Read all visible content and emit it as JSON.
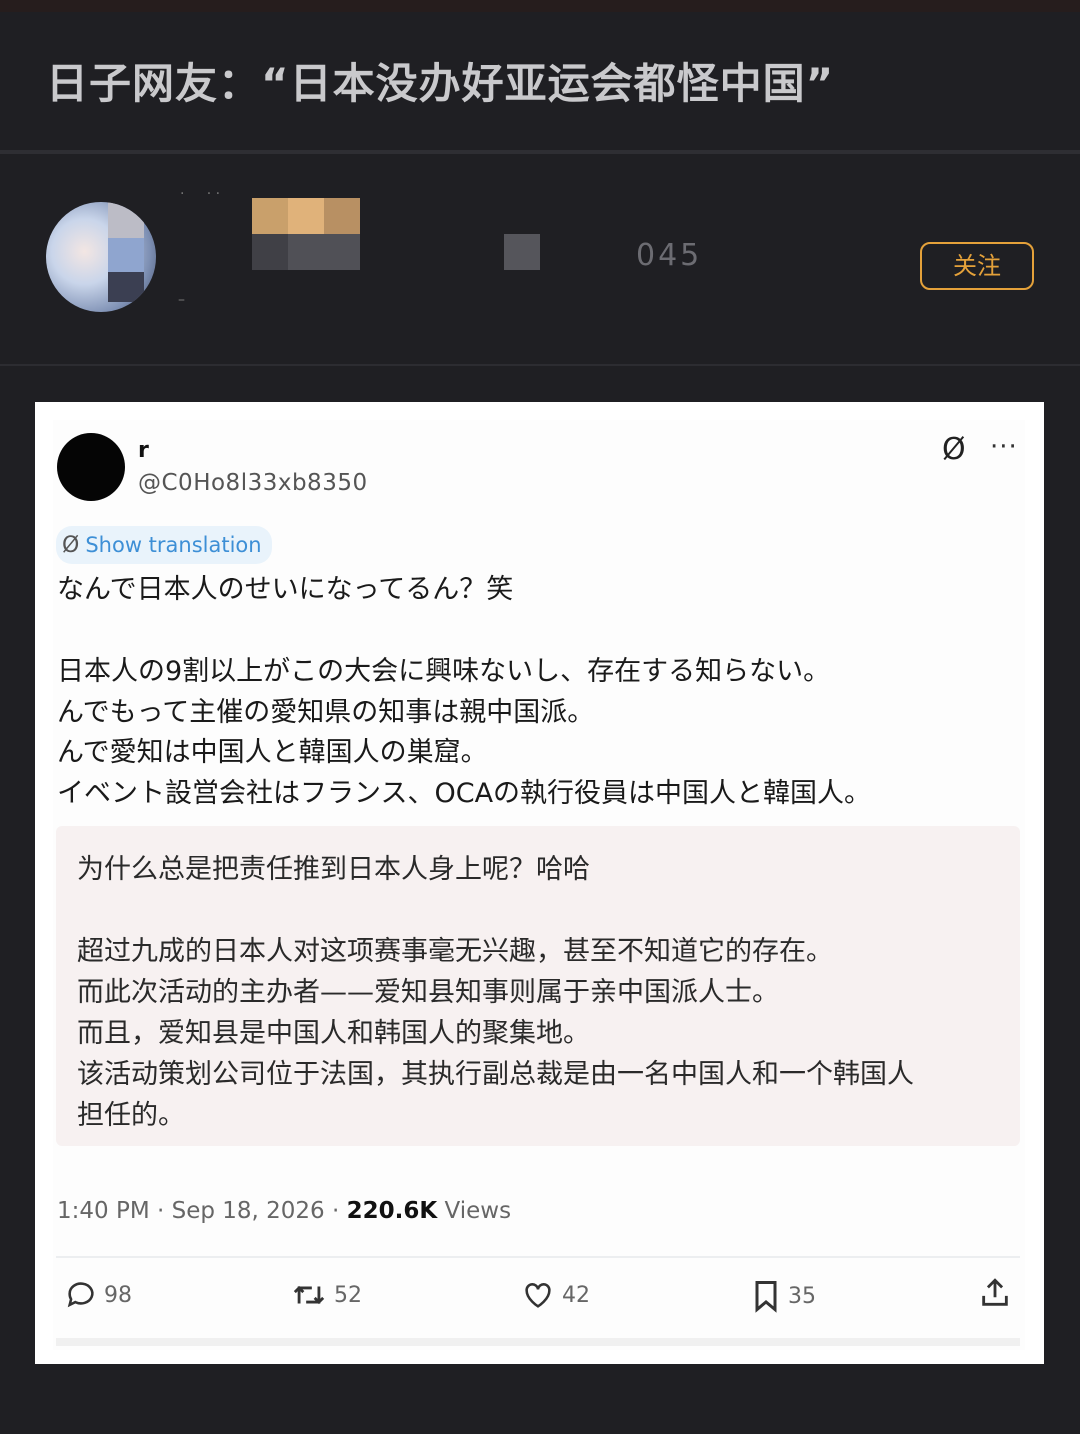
{
  "article": {
    "title": "日子网友：“日本没办好亚运会都怪中国”"
  },
  "author": {
    "followers_fragment": "045",
    "follow_label": "关注"
  },
  "tweet": {
    "name": "r",
    "handle": "@C0Ho8l33xb8350",
    "grok_icon": "Ø",
    "more_icon": "···",
    "show_translation": "Show translation",
    "original_lines": [
      "なんで日本人のせいになってるん？笑",
      "日本人の9割以上がこの大会に興味ないし、存在する知らない。",
      "んでもって主催の愛知県の知事は親中国派。",
      "んで愛知は中国人と韓国人の巣窟。",
      "イベント設営会社はフランス、OCAの執行役員は中国人と韓国人。"
    ],
    "translation_lines": [
      "为什么总是把责任推到日本人身上呢？哈哈",
      "超过九成的日本人对这项赛事毫无兴趣，甚至不知道它的存在。",
      "而此次活动的主办者——爱知县知事则属于亲中国派人士。",
      "而且，爱知县是中国人和韩国人的聚集地。",
      "该活动策划公司位于法国，其执行副总裁是由一名中国人和一个韩国人",
      "担任的。"
    ],
    "timestamp": "1:40 PM · Sep 18, 2026 · ",
    "views_count": "220.6K",
    "views_label": " Views",
    "actions": {
      "reply": "98",
      "retweet": "52",
      "like": "42",
      "bookmark": "35"
    }
  }
}
